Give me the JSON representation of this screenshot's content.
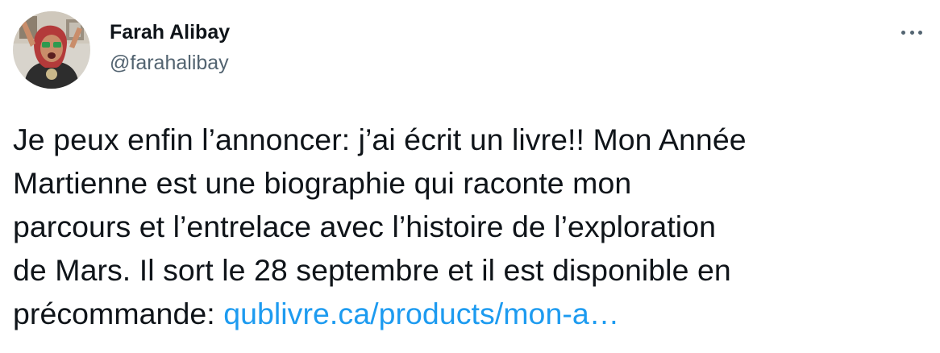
{
  "author": {
    "display_name": "Farah Alibay",
    "handle": "@farahalibay"
  },
  "tweet": {
    "lines": [
      "Je peux enfin l’annoncer: j’ai écrit un livre!! Mon Année",
      "Martienne est une biographie qui raconte mon",
      "parcours et l’entrelace avec l’histoire de l’exploration",
      "de Mars. Il sort le 28 septembre et il est disponible en"
    ],
    "last_line_prefix": "précommande: ",
    "link_text": "qublivre.ca/products/mon-a…"
  },
  "icons": {
    "more": "more-options-icon"
  },
  "colors": {
    "text": "#0f1419",
    "secondary": "#536471",
    "link": "#1d9bf0"
  }
}
